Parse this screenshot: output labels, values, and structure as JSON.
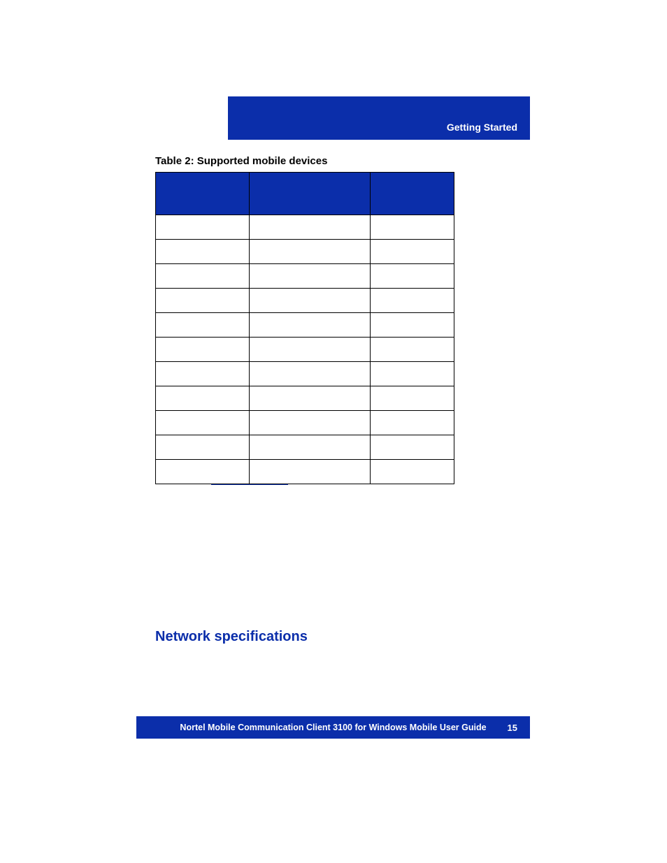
{
  "header": {
    "section_name": "Getting Started"
  },
  "table": {
    "caption": "Table 2: Supported mobile devices",
    "headers": [
      "",
      "",
      ""
    ],
    "rows": [
      [
        "",
        "",
        ""
      ],
      [
        "",
        "",
        ""
      ],
      [
        "",
        "",
        ""
      ],
      [
        "",
        "",
        ""
      ],
      [
        "",
        "",
        ""
      ],
      [
        "",
        "",
        ""
      ],
      [
        "",
        "",
        ""
      ],
      [
        "",
        "",
        ""
      ],
      [
        "",
        "",
        ""
      ],
      [
        "",
        "",
        ""
      ],
      [
        "",
        "",
        ""
      ]
    ]
  },
  "section": {
    "heading": "Network specifications"
  },
  "footer": {
    "title": "Nortel Mobile Communication Client 3100 for Windows Mobile User Guide",
    "page_number": "15"
  }
}
